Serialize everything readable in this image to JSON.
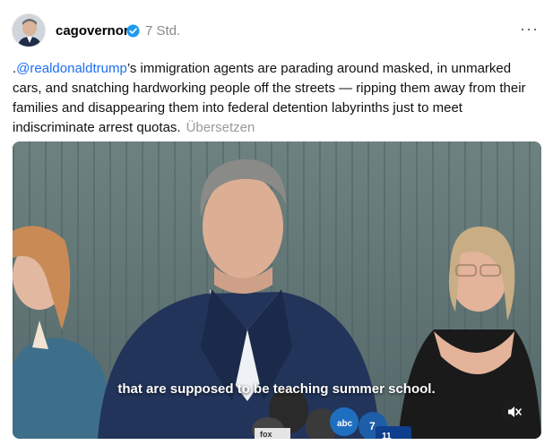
{
  "post": {
    "username": "cagovernor",
    "verified": true,
    "timestamp": "7 Std.",
    "more_label": "···",
    "text_prefix": ".",
    "mention": "@realdonaldtrump",
    "text_body": "’s immigration agents are parading around masked, in unmarked cars, and snatching hardworking people off the streets — ripping them away from their families and disappearing them into federal detention labyrinths just to meet indiscriminate arrest quotas.",
    "translate_label": "Übersetzen"
  },
  "video": {
    "caption": "that are supposed to be teaching summer school.",
    "muted": true,
    "mic_labels": [
      "abc",
      "7",
      "fox",
      "11"
    ]
  },
  "colors": {
    "mention": "#1d6ff2",
    "verified_badge": "#1d9bf0",
    "wall": "#5f7370"
  }
}
